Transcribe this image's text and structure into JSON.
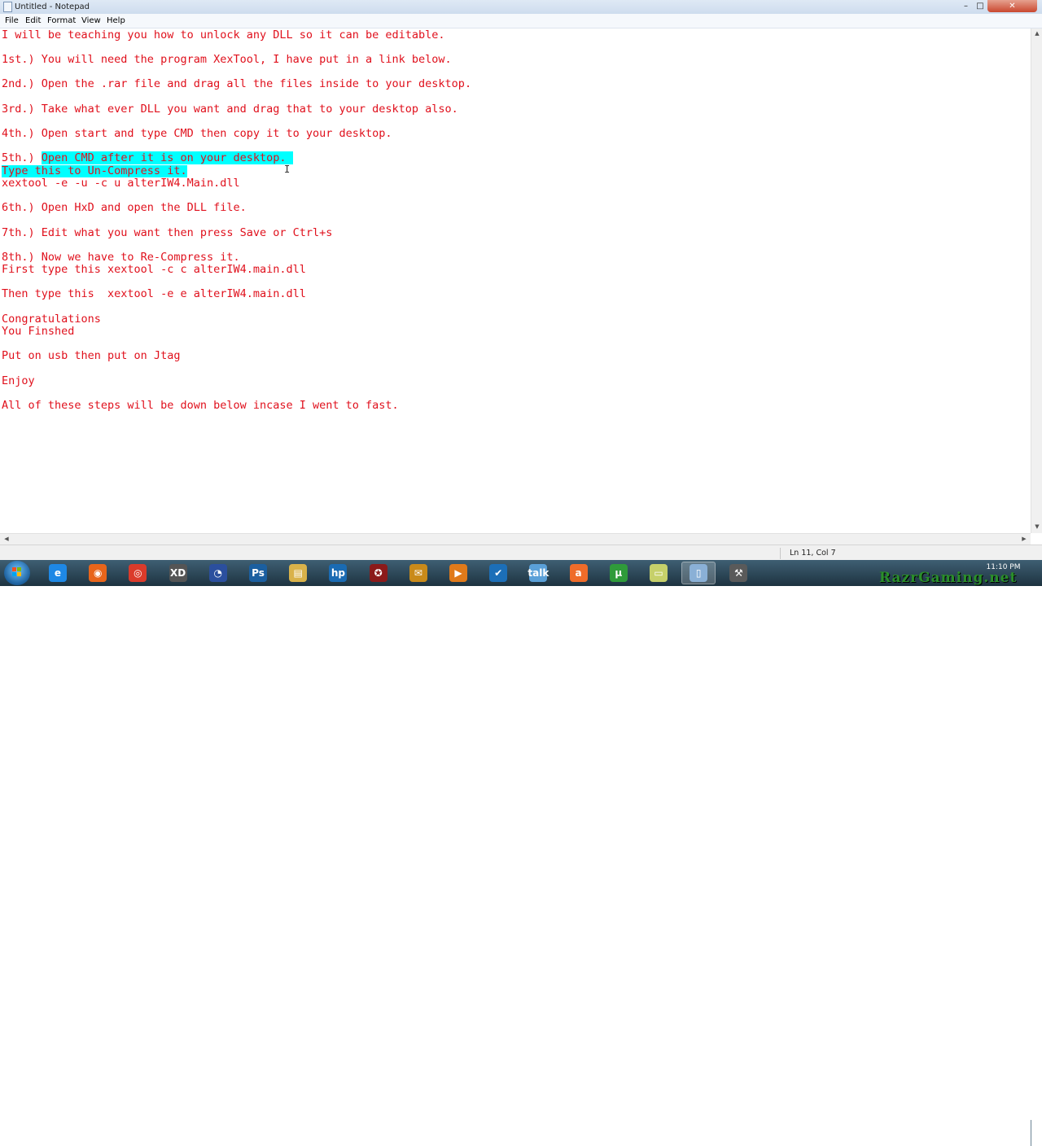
{
  "window": {
    "title": "Untitled - Notepad",
    "buttons": {
      "minimize": "–",
      "maximize": "□",
      "close": "✕"
    }
  },
  "menu": [
    "File",
    "Edit",
    "Format",
    "View",
    "Help"
  ],
  "document": {
    "lines": [
      "I will be teaching you how to unlock any DLL so it can be editable.",
      "1st.) You will need the program XexTool, I have put in a link below.",
      "2nd.) Open the .rar file and drag all the files inside to your desktop.",
      "3rd.) Take what ever DLL you want and drag that to your desktop also.",
      "4th.) Open start and type CMD then copy it to your desktop.",
      "5th.) ",
      "Open CMD after it is on your desktop. ",
      "Type this to Un-Compress it.",
      "xextool -e -u -c u alterIW4.Main.dll",
      "6th.) Open HxD and open the DLL file.",
      "7th.) Edit what you want then press Save or Ctrl+s",
      "8th.) Now we have to Re-Compress it.",
      "First type this xextool -c c alterIW4.main.dll",
      "Then type this  xextool -e e alterIW4.main.dll",
      "Congratulations",
      "You Finshed",
      "Put on usb then put on Jtag",
      "Enjoy",
      "All of these steps will be down below incase I went to fast."
    ],
    "text_color": "#e0101c",
    "highlight_color": "#00ffff"
  },
  "status": {
    "position": "Ln 11, Col 7"
  },
  "taskbar": {
    "apps": [
      {
        "name": "internet-explorer-icon",
        "glyph": "e",
        "color": "#1e88e5"
      },
      {
        "name": "firefox-icon",
        "glyph": "◉",
        "color": "#e8651b"
      },
      {
        "name": "chrome-icon",
        "glyph": "◎",
        "color": "#db3b2b"
      },
      {
        "name": "xd-app-icon",
        "glyph": "XD",
        "color": "#555555"
      },
      {
        "name": "cinema4d-icon",
        "glyph": "◔",
        "color": "#2b4f9e"
      },
      {
        "name": "photoshop-icon",
        "glyph": "Ps",
        "color": "#1b5fa0"
      },
      {
        "name": "folder-icon",
        "glyph": "▤",
        "color": "#d9b24a"
      },
      {
        "name": "hp-icon",
        "glyph": "hp",
        "color": "#1a6bb3"
      },
      {
        "name": "game-icon",
        "glyph": "✪",
        "color": "#8b1a1a"
      },
      {
        "name": "bubble-icon",
        "glyph": "✉",
        "color": "#c98a1a"
      },
      {
        "name": "media-player-icon",
        "glyph": "▶",
        "color": "#e07a1a"
      },
      {
        "name": "checkmark-app-icon",
        "glyph": "✔",
        "color": "#1c6fb8"
      },
      {
        "name": "gtalk-icon",
        "glyph": "talk",
        "color": "#5aa0d8"
      },
      {
        "name": "avast-icon",
        "glyph": "a",
        "color": "#ef6c2a"
      },
      {
        "name": "utorrent-icon",
        "glyph": "µ",
        "color": "#2f9b3a"
      },
      {
        "name": "notes-icon",
        "glyph": "▭",
        "color": "#c6d06a"
      },
      {
        "name": "notepad-taskbar-icon",
        "glyph": "▯",
        "color": "#8ab0d6"
      },
      {
        "name": "tools-icon",
        "glyph": "⚒",
        "color": "#5a5a5a"
      }
    ],
    "clock_time": "11:10 PM"
  }
}
